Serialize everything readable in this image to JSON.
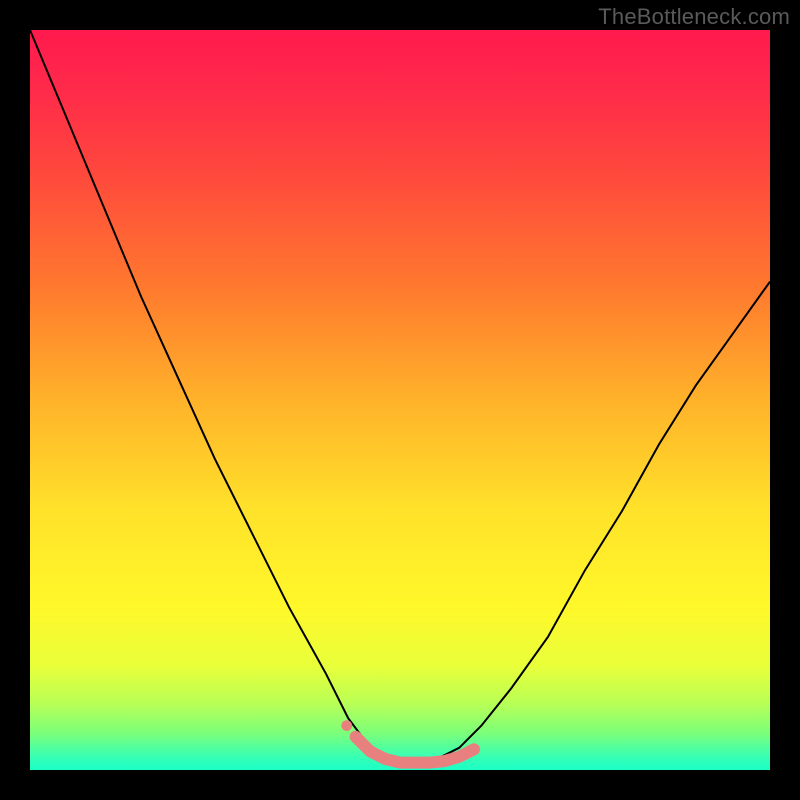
{
  "watermark": "TheBottleneck.com",
  "chart_data": {
    "type": "line",
    "title": "",
    "xlabel": "",
    "ylabel": "",
    "xlim": [
      0,
      100
    ],
    "ylim": [
      0,
      100
    ],
    "grid": false,
    "background_gradient": {
      "top": "#ff1a4d",
      "middle": "#ffe22a",
      "bottom": "#1affc8"
    },
    "series": [
      {
        "name": "bottleneck-curve",
        "color": "#000000",
        "stroke_width": 2,
        "x": [
          0,
          5,
          10,
          15,
          20,
          25,
          30,
          35,
          40,
          43,
          46,
          50,
          54,
          58,
          61,
          65,
          70,
          75,
          80,
          85,
          90,
          95,
          100
        ],
        "y": [
          100,
          88,
          76,
          64,
          53,
          42,
          32,
          22,
          13,
          7,
          3,
          1,
          1,
          3,
          6,
          11,
          18,
          27,
          35,
          44,
          52,
          59,
          66
        ]
      },
      {
        "name": "optimum-marker",
        "type": "scatter",
        "color": "#e98080",
        "marker_size": 12,
        "x": [
          44,
          46,
          48,
          50,
          52,
          54,
          56,
          58,
          60
        ],
        "y": [
          4.5,
          2.5,
          1.5,
          1.0,
          1.0,
          1.0,
          1.2,
          1.8,
          2.8
        ]
      }
    ]
  }
}
